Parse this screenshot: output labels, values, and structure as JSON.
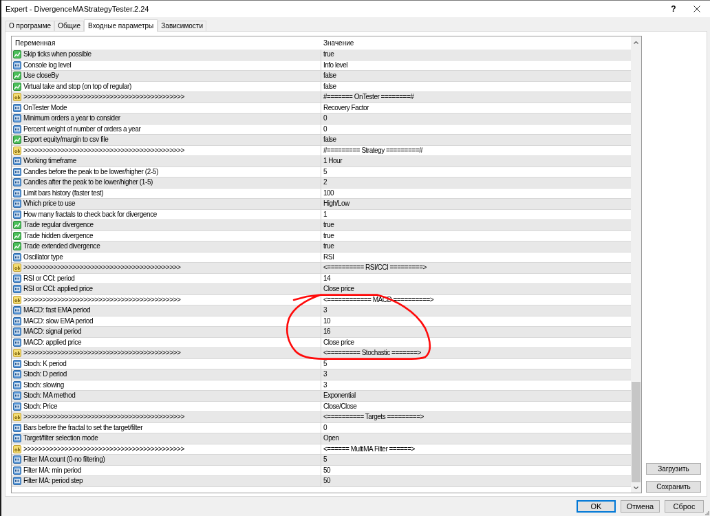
{
  "window": {
    "title": "Expert - DivergenceMAStrategyTester.2.24",
    "help_button": "?"
  },
  "tabs": [
    {
      "label": "О программе",
      "selected": false
    },
    {
      "label": "Общие",
      "selected": false
    },
    {
      "label": "Входные параметры",
      "selected": true
    },
    {
      "label": "Зависимости",
      "selected": false
    }
  ],
  "table": {
    "columns": [
      "Переменная",
      "Значение"
    ],
    "rows": [
      {
        "kind": "bool",
        "variable": "Skip ticks when possible",
        "value": "true"
      },
      {
        "kind": "number",
        "variable": "Console log level",
        "value": "Info level"
      },
      {
        "kind": "bool",
        "variable": "Use closeBy",
        "value": "false"
      },
      {
        "kind": "bool",
        "variable": "Virtual take and stop (on top of regular)",
        "value": "false"
      },
      {
        "kind": "string",
        "variable": ">>>>>>>>>>>>>>>>>>>>>>>>>>>>>>>>>>>>>>>>>>>",
        "value": "#======= OnTester ========#"
      },
      {
        "kind": "number",
        "variable": "OnTester Mode",
        "value": "Recovery Factor"
      },
      {
        "kind": "number",
        "variable": "Minimum orders a year to consider",
        "value": "0"
      },
      {
        "kind": "number",
        "variable": "Percent weight of number of orders a year",
        "value": "0"
      },
      {
        "kind": "bool",
        "variable": "Export equity/margin to csv file",
        "value": "false"
      },
      {
        "kind": "string",
        "variable": ">>>>>>>>>>>>>>>>>>>>>>>>>>>>>>>>>>>>>>>>>>>",
        "value": "#========= Strategy =========#"
      },
      {
        "kind": "number",
        "variable": "Working timeframe",
        "value": "1 Hour"
      },
      {
        "kind": "number",
        "variable": "Candles before the peak to be lower/higher (2-5)",
        "value": "5"
      },
      {
        "kind": "number",
        "variable": "Candles after the peak to be lower/higher (1-5)",
        "value": "2"
      },
      {
        "kind": "number",
        "variable": "Limit bars history (faster test)",
        "value": "100"
      },
      {
        "kind": "number",
        "variable": "Which price to use",
        "value": "High/Low"
      },
      {
        "kind": "number",
        "variable": "How many fractals to check back for divergence",
        "value": "1"
      },
      {
        "kind": "bool",
        "variable": "Trade regular divergence",
        "value": "true"
      },
      {
        "kind": "bool",
        "variable": "Trade hidden divergence",
        "value": "true"
      },
      {
        "kind": "bool",
        "variable": "Trade extended divergence",
        "value": "true"
      },
      {
        "kind": "number",
        "variable": "Oscillator type",
        "value": "RSI"
      },
      {
        "kind": "string",
        "variable": ">>>>>>>>>>>>>>>>>>>>>>>>>>>>>>>>>>>>>>>>>>",
        "value": "<========== RSI/CCI =========>"
      },
      {
        "kind": "number",
        "variable": "RSI or CCI: period",
        "value": "14"
      },
      {
        "kind": "number",
        "variable": "RSI or CCI: applied price",
        "value": "Close price"
      },
      {
        "kind": "string",
        "variable": ">>>>>>>>>>>>>>>>>>>>>>>>>>>>>>>>>>>>>>>>>>",
        "value": "<============ MACD ==========>"
      },
      {
        "kind": "number",
        "variable": "MACD: fast EMA period",
        "value": "3"
      },
      {
        "kind": "number",
        "variable": "MACD: slow EMA period",
        "value": "10"
      },
      {
        "kind": "number",
        "variable": "MACD: signal period",
        "value": "16"
      },
      {
        "kind": "number",
        "variable": "MACD: applied price",
        "value": "Close price"
      },
      {
        "kind": "string",
        "variable": ">>>>>>>>>>>>>>>>>>>>>>>>>>>>>>>>>>>>>>>>>>",
        "value": "<========= Stochastic =======>"
      },
      {
        "kind": "number",
        "variable": "Stoch: K period",
        "value": "5"
      },
      {
        "kind": "number",
        "variable": "Stoch: D period",
        "value": "3"
      },
      {
        "kind": "number",
        "variable": "Stoch: slowing",
        "value": "3"
      },
      {
        "kind": "number",
        "variable": "Stoch: MA method",
        "value": "Exponential"
      },
      {
        "kind": "number",
        "variable": "Stoch: Price",
        "value": "Close/Close"
      },
      {
        "kind": "string",
        "variable": ">>>>>>>>>>>>>>>>>>>>>>>>>>>>>>>>>>>>>>>>>>>",
        "value": "<========== Targets =========>"
      },
      {
        "kind": "number",
        "variable": "Bars before the fractal to set the target/filter",
        "value": "0"
      },
      {
        "kind": "number",
        "variable": "Target/filter selection mode",
        "value": "Open"
      },
      {
        "kind": "string",
        "variable": ">>>>>>>>>>>>>>>>>>>>>>>>>>>>>>>>>>>>>>>>>>>",
        "value": "<====== MultiMA Filter ======>"
      },
      {
        "kind": "number",
        "variable": "Filter MA count (0-no filtering)",
        "value": "5"
      },
      {
        "kind": "number",
        "variable": "Filter MA: min period",
        "value": "50"
      },
      {
        "kind": "number",
        "variable": "Filter MA: period step",
        "value": "50"
      }
    ]
  },
  "side_buttons": [
    "Загрузить",
    "Сохранить"
  ],
  "dialog_buttons": [
    {
      "label": "OK",
      "default": true
    },
    {
      "label": "Отмена",
      "default": false
    },
    {
      "label": "Сброс",
      "default": false
    }
  ]
}
